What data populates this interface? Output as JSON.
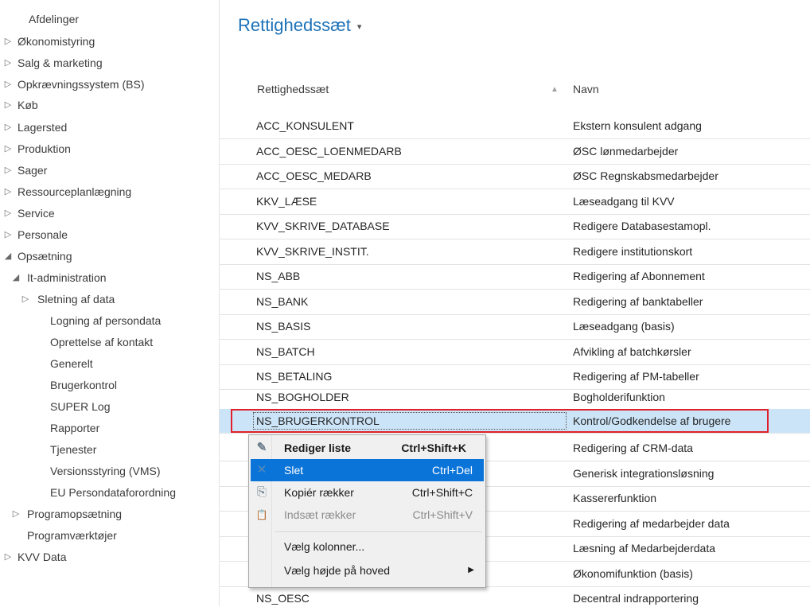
{
  "sidebar": {
    "items": [
      {
        "label": "Afdelinger",
        "arrow": ""
      },
      {
        "label": "Økonomistyring",
        "arrow": "▷"
      },
      {
        "label": "Salg & marketing",
        "arrow": "▷"
      },
      {
        "label": "Opkrævningssystem (BS)",
        "arrow": "▷"
      },
      {
        "label": "Køb",
        "arrow": "▷"
      },
      {
        "label": "Lagersted",
        "arrow": "▷"
      },
      {
        "label": "Produktion",
        "arrow": "▷"
      },
      {
        "label": "Sager",
        "arrow": "▷"
      },
      {
        "label": "Ressourceplanlægning",
        "arrow": "▷"
      },
      {
        "label": "Service",
        "arrow": "▷"
      },
      {
        "label": "Personale",
        "arrow": "▷"
      },
      {
        "label": "Opsætning",
        "arrow": "◢"
      },
      {
        "label": "It-administration",
        "arrow": "◢"
      },
      {
        "label": "Sletning af data",
        "arrow": "▷"
      },
      {
        "label": "Logning af persondata",
        "arrow": ""
      },
      {
        "label": "Oprettelse af kontakt",
        "arrow": ""
      },
      {
        "label": "Generelt",
        "arrow": ""
      },
      {
        "label": "Brugerkontrol",
        "arrow": ""
      },
      {
        "label": "SUPER Log",
        "arrow": ""
      },
      {
        "label": "Rapporter",
        "arrow": ""
      },
      {
        "label": "Tjenester",
        "arrow": ""
      },
      {
        "label": "Versionsstyring (VMS)",
        "arrow": ""
      },
      {
        "label": "EU Persondataforordning",
        "arrow": ""
      },
      {
        "label": "Programopsætning",
        "arrow": "▷"
      },
      {
        "label": "Programværktøjer",
        "arrow": ""
      },
      {
        "label": "KVV Data",
        "arrow": "▷"
      }
    ]
  },
  "page": {
    "title": "Rettighedssæt",
    "title_caret": "▾"
  },
  "table": {
    "columns": [
      "Rettighedssæt",
      "Navn"
    ],
    "sort_indicator": "▲",
    "rows": [
      {
        "code": "ACC_KONSULENT",
        "name": "Ekstern konsulent adgang"
      },
      {
        "code": "ACC_OESC_LOENMEDARB",
        "name": "ØSC lønmedarbejder"
      },
      {
        "code": "ACC_OESC_MEDARB",
        "name": "ØSC Regnskabsmedarbejder"
      },
      {
        "code": "KKV_LÆSE",
        "name": "Læseadgang til KVV"
      },
      {
        "code": "KVV_SKRIVE_DATABASE",
        "name": "Redigere Databasestamopl."
      },
      {
        "code": "KVV_SKRIVE_INSTIT.",
        "name": "Redigere institutionskort"
      },
      {
        "code": "NS_ABB",
        "name": "Redigering af Abonnement"
      },
      {
        "code": "NS_BANK",
        "name": "Redigering af banktabeller"
      },
      {
        "code": "NS_BASIS",
        "name": "Læseadgang (basis)"
      },
      {
        "code": "NS_BATCH",
        "name": "Afvikling af batchkørsler"
      },
      {
        "code": "NS_BETALING",
        "name": "Redigering af PM-tabeller"
      },
      {
        "code": "NS_BOGHOLDER",
        "name": "Bogholderifunktion"
      },
      {
        "code": "NS_BRUGERKONTROL",
        "name": "Kontrol/Godkendelse af brugere"
      },
      {
        "code": "",
        "name": "Redigering af CRM-data"
      },
      {
        "code": "",
        "name": "Generisk integrationsløsning"
      },
      {
        "code": "",
        "name": "Kassererfunktion"
      },
      {
        "code": "",
        "name": "Redigering af medarbejder data"
      },
      {
        "code": "",
        "name": "Læsning af Medarbejderdata"
      },
      {
        "code": "",
        "name": "Økonomifunktion (basis)"
      },
      {
        "code": "NS_OESC",
        "name": "Decentral indrapportering"
      }
    ],
    "selected_index": 12
  },
  "context_menu": {
    "items": [
      {
        "label": "Rediger liste",
        "shortcut": "Ctrl+Shift+K",
        "icon": "✎",
        "bold": true
      },
      {
        "label": "Slet",
        "shortcut": "Ctrl+Del",
        "icon": "✕",
        "active": true
      },
      {
        "label": "Kopiér rækker",
        "shortcut": "Ctrl+Shift+C",
        "icon": "⎘"
      },
      {
        "label": "Indsæt rækker",
        "shortcut": "Ctrl+Shift+V",
        "icon": "📋",
        "disabled": true
      },
      {
        "label": "Vælg kolonner...",
        "shortcut": "",
        "icon": ""
      },
      {
        "label": "Vælg højde på hoved",
        "shortcut": "",
        "icon": "",
        "submenu": "▶"
      }
    ]
  },
  "colors": {
    "accent_title": "#1d72b8",
    "selection_row": "#cce4f7",
    "highlight_border": "#e0202a",
    "menu_active": "#0a74d9"
  }
}
